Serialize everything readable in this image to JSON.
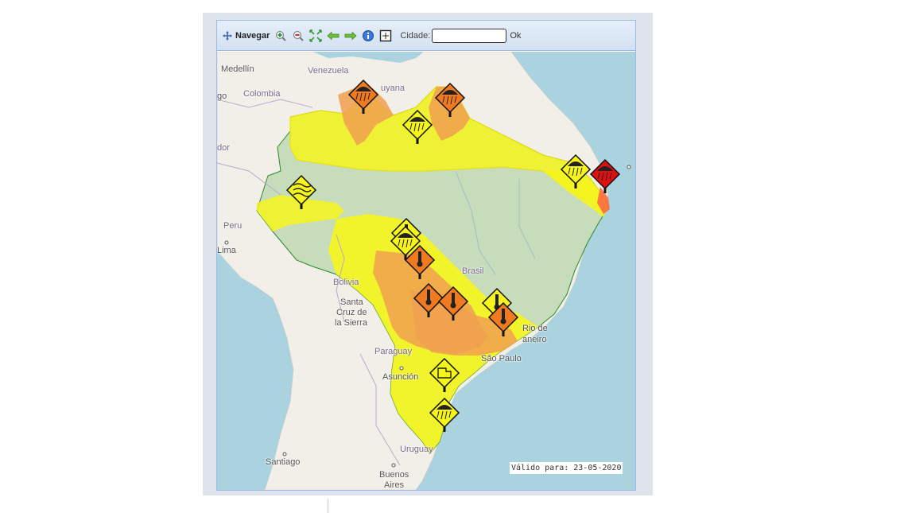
{
  "toolbar": {
    "navigate_label": "Navegar",
    "city_label": "Cidade:",
    "city_value": "",
    "ok_label": "Ok",
    "icons": [
      "pan-icon",
      "zoom-in-icon",
      "zoom-out-icon",
      "zoom-extent-icon",
      "back-icon",
      "forward-icon",
      "info-icon",
      "select-box-icon"
    ]
  },
  "map": {
    "places": {
      "medellin": "Medellín",
      "venezuela": "Venezuela",
      "guyana": "uyana",
      "colombia": "Colombia",
      "bogota": "go",
      "ecuador": "dor",
      "peru": "Peru",
      "lima": "Lima",
      "bolivia": "Bolivia",
      "santa_cruz_1": "Santa",
      "santa_cruz_2": "Cruz de",
      "santa_cruz_3": "la Sierra",
      "brasil": "Brasil",
      "paraguay": "Paraguay",
      "asuncion": "Asunción",
      "rio_1": "Rio de",
      "rio_2": "aneiro",
      "sao_paulo": "São Paulo",
      "uruguay": "Uruguay",
      "santiago": "Santiago",
      "buenos_aires_1": "Buenos",
      "buenos_aires_2": "Aires"
    },
    "validity": "Válido para: 23-05-2020",
    "colors": {
      "ocean": "#aad3df",
      "land": "#f2efe9",
      "brazil": "#c6dcbb",
      "yellow_alert": "#f5f51c",
      "orange_alert": "#f0a050",
      "red_alert": "#ff3010"
    },
    "alert_signs": [
      {
        "level": "orange",
        "icon": "storm-icon"
      },
      {
        "level": "orange",
        "icon": "storm-icon"
      },
      {
        "level": "yellow",
        "icon": "storm-icon"
      },
      {
        "level": "yellow",
        "icon": "storm-icon"
      },
      {
        "level": "red",
        "icon": "storm-icon"
      },
      {
        "level": "yellow",
        "icon": "wind-icon"
      },
      {
        "level": "yellow",
        "icon": "temperature-icon"
      },
      {
        "level": "yellow",
        "icon": "storm-icon"
      },
      {
        "level": "orange",
        "icon": "temperature-icon"
      },
      {
        "level": "orange",
        "icon": "temperature-icon"
      },
      {
        "level": "orange",
        "icon": "temperature-icon"
      },
      {
        "level": "yellow",
        "icon": "temperature-icon"
      },
      {
        "level": "orange",
        "icon": "temperature-icon"
      },
      {
        "level": "yellow",
        "icon": "frost-icon"
      },
      {
        "level": "yellow",
        "icon": "storm-icon"
      }
    ]
  }
}
